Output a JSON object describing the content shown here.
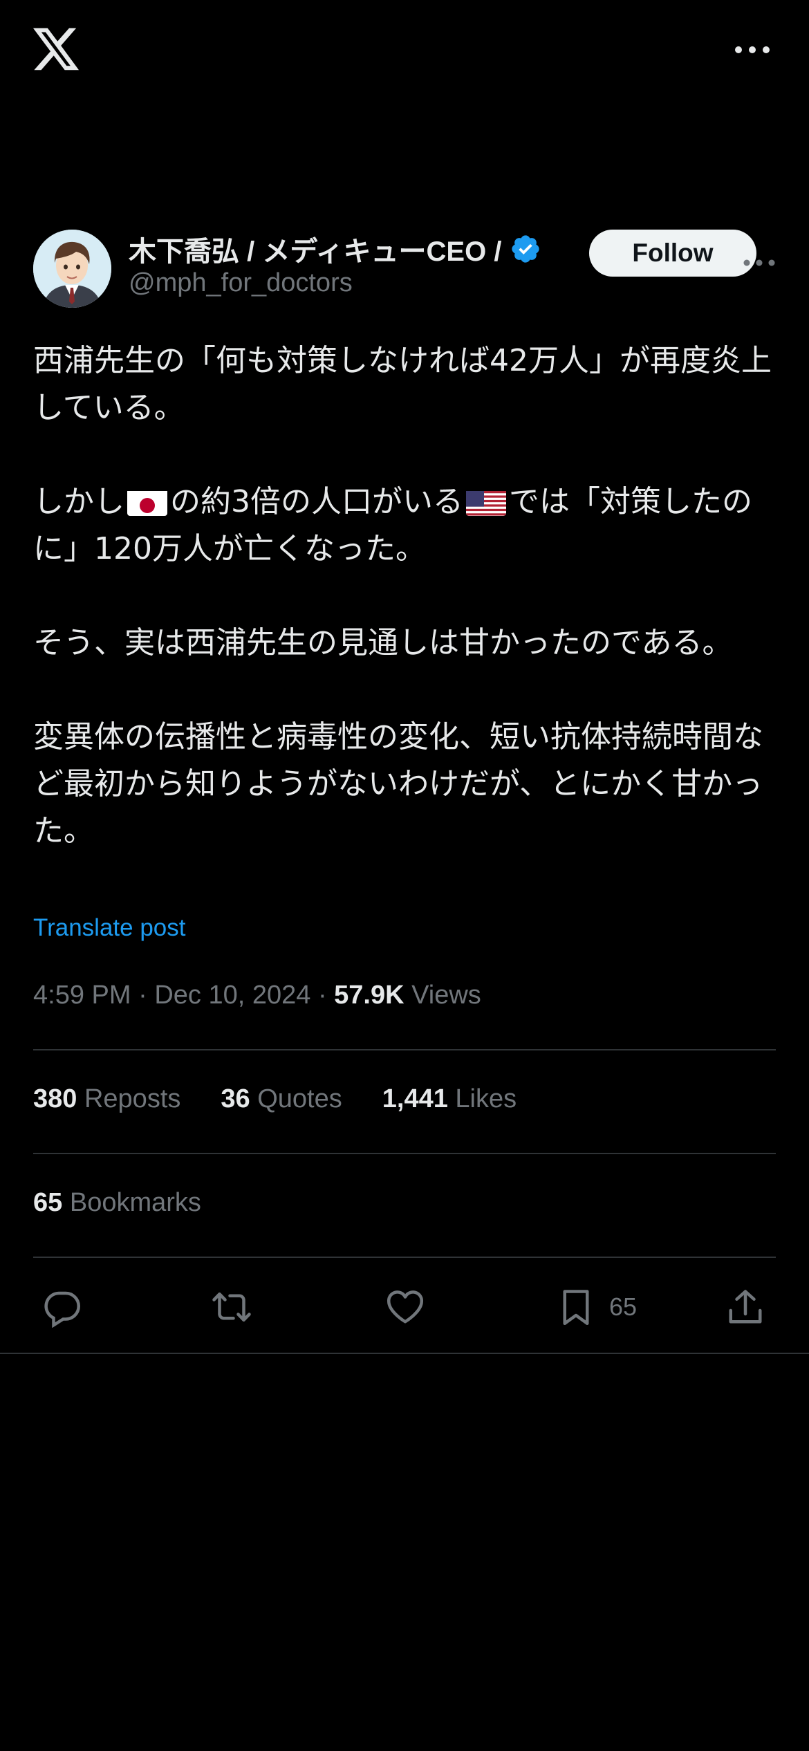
{
  "header": {
    "logo_icon": "x-logo-icon",
    "more_icon": "more-horizontal-icon"
  },
  "author": {
    "name": "木下喬弘 / メディキューCEO /",
    "handle": "@mph_for_doctors",
    "verified_icon": "verified-badge-icon",
    "verified_color": "#1d9bf0",
    "follow_label": "Follow"
  },
  "post": {
    "para1": "西浦先生の「何も対策しなければ42万人」が再度炎上している。",
    "para2_a": "しかし",
    "para2_flag1": "japan-flag-icon",
    "para2_b": "の約3倍の人口がいる",
    "para2_flag2": "us-flag-icon",
    "para2_c": "では「対策したのに」120万人が亡くなった。",
    "para3": "そう、実は西浦先生の見通しは甘かったのである。",
    "para4": "変異体の伝播性と病毒性の変化、短い抗体持続時間など最初から知りようがないわけだが、とにかく甘かった。"
  },
  "translate_label": "Translate post",
  "meta": {
    "time": "4:59 PM",
    "sep1": "·",
    "date": "Dec 10, 2024",
    "sep2": "·",
    "views_count": "57.9K",
    "views_label": "Views"
  },
  "stats": {
    "reposts_count": "380",
    "reposts_label": "Reposts",
    "quotes_count": "36",
    "quotes_label": "Quotes",
    "likes_count": "1,441",
    "likes_label": "Likes",
    "bookmarks_count": "65",
    "bookmarks_label": "Bookmarks"
  },
  "actions": {
    "reply_icon": "reply-icon",
    "repost_icon": "repost-icon",
    "like_icon": "heart-icon",
    "bookmark_icon": "bookmark-icon",
    "bookmark_count": "65",
    "share_icon": "share-icon"
  },
  "colors": {
    "background": "#000000",
    "text": "#e7e9ea",
    "secondary": "#71767b",
    "accent": "#1d9bf0",
    "divider": "#2f3336"
  }
}
